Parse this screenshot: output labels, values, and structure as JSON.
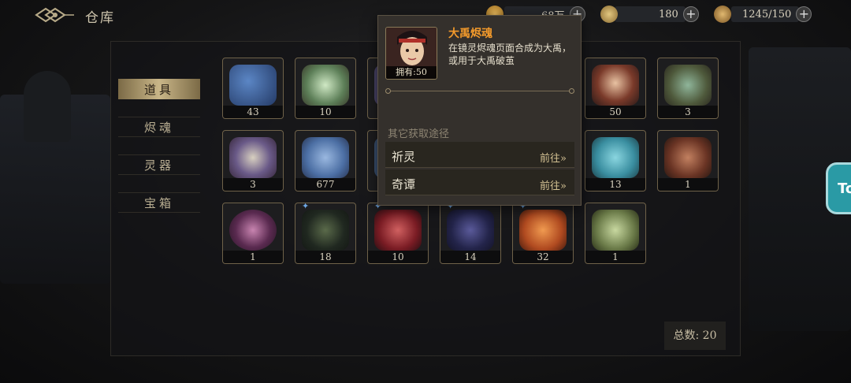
{
  "header": {
    "title": "仓库",
    "resources": [
      {
        "name": "gold-icon",
        "value": "68万"
      },
      {
        "name": "spiral-icon",
        "value": "180"
      },
      {
        "name": "stamina-icon",
        "value": "1245/150"
      }
    ]
  },
  "sidebar": {
    "items": [
      {
        "label": "道具",
        "active": true
      },
      {
        "label": "烬魂",
        "active": false
      },
      {
        "label": "灵器",
        "active": false
      },
      {
        "label": "宝箱",
        "active": false
      }
    ]
  },
  "inventory": {
    "items": [
      {
        "icon": "blue-map-icon",
        "count": "43"
      },
      {
        "icon": "lotus-icon",
        "count": "10"
      },
      {
        "icon": "hidden-item-icon",
        "count": ""
      },
      {
        "icon": "hidden-item-icon",
        "count": ""
      },
      {
        "icon": "hidden-item-icon",
        "count": ""
      },
      {
        "icon": "hidden-item-icon",
        "count": ""
      },
      {
        "icon": "dayu-portrait-icon",
        "count": "50"
      },
      {
        "icon": "jade-scroll-icon",
        "count": "3"
      },
      {
        "icon": "wine-tray-icon",
        "count": "3"
      },
      {
        "icon": "blue-spirit-icon",
        "count": "677"
      },
      {
        "icon": "hidden-item-icon",
        "count": ""
      },
      {
        "icon": "hidden-item-icon",
        "count": ""
      },
      {
        "icon": "hidden-item-icon",
        "count": ""
      },
      {
        "icon": "hidden-item-icon",
        "count": ""
      },
      {
        "icon": "teal-spirit-icon",
        "count": "13"
      },
      {
        "icon": "urn-icon",
        "count": "1"
      },
      {
        "icon": "purple-orb-icon",
        "count": "1"
      },
      {
        "icon": "dark-spirit-icon",
        "count": "18"
      },
      {
        "icon": "red-spirit-icon",
        "count": "10"
      },
      {
        "icon": "navy-spirit-icon",
        "count": "14"
      },
      {
        "icon": "orange-spirit-icon",
        "count": "32"
      },
      {
        "icon": "green-jade-icon",
        "count": "1"
      }
    ],
    "total_label": "总数: 20"
  },
  "tooltip": {
    "name": "大禹烬魂",
    "owned": "拥有:50",
    "description": "在镜灵烬魂页面合成为大禹，或用于大禹破茧",
    "subheading": "其它获取途径",
    "sources": [
      {
        "label": "祈灵",
        "action": "前往»"
      },
      {
        "label": "奇谭",
        "action": "前往»"
      }
    ]
  },
  "floating_button": {
    "label": "To"
  }
}
